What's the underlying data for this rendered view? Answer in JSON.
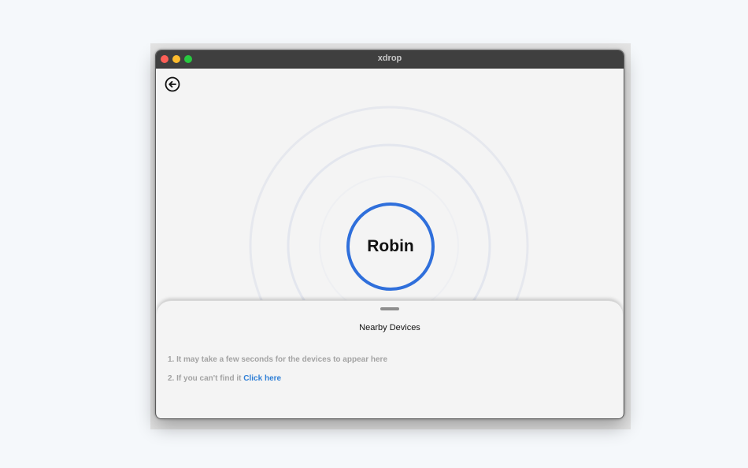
{
  "window": {
    "title": "xdrop"
  },
  "main": {
    "device_name": "Robin"
  },
  "sheet": {
    "title": "Nearby Devices",
    "hint_1": "1. It may take a few seconds for the devices to appear here",
    "hint_2_prefix": "2. If you can't find it",
    "hint_2_link": "Click here"
  },
  "icons": {
    "back": "back-arrow-circle-icon"
  },
  "colors": {
    "accent": "#2f6fdb",
    "link": "#2f7fd6",
    "titlebar": "#3f3f3f",
    "background": "#f4f4f4",
    "hint_text": "#a3a3a3"
  }
}
